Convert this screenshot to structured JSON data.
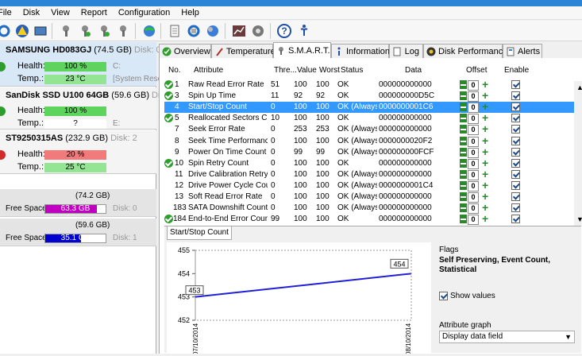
{
  "menu": [
    "File",
    "Disk",
    "View",
    "Report",
    "Configuration",
    "Help"
  ],
  "toolbar": [
    "refresh-icon",
    "warning-icon",
    "disk-icon",
    "wrench-icon",
    "wrench-icon",
    "wrench-icon",
    "wrench-icon",
    "globe-icon",
    "document-icon",
    "refresh-icon",
    "globe-arrows-icon",
    "chart-icon",
    "settings-icon",
    "help-icon",
    "info-icon"
  ],
  "disks": [
    {
      "name": "SAMSUNG HD083GJ",
      "size": "(74.5 GB)",
      "disk": "Disk: 0",
      "health_label": "Health:",
      "health": "100 %",
      "health_pct": 100,
      "health_color": "#5ed35e",
      "temp_label": "Temp.:",
      "temp": "23 °C",
      "temp_color": "#93e493",
      "vol1": "C:",
      "vol2": "[System Rese",
      "status": "ok"
    },
    {
      "name": "SanDisk SSD U100 64GB",
      "size": "(59.6 GB)",
      "disk": "Disk: 1",
      "health_label": "Health:",
      "health": "100 %",
      "health_pct": 100,
      "health_color": "#5ed35e",
      "temp_label": "Temp.:",
      "temp": "?",
      "temp_color": "#ffffff",
      "vol1": "E:",
      "vol2": "",
      "status": "ok"
    },
    {
      "name": "ST9250315AS",
      "size": "(232.9 GB)",
      "disk": "Disk: 2",
      "health_label": "Health:",
      "health": "20 %",
      "health_pct": 20,
      "health_color": "#f17a7a",
      "temp_label": "Temp.:",
      "temp": "25 °C",
      "temp_color": "#93e493",
      "vol1": "",
      "vol2": "",
      "status": "bad"
    }
  ],
  "volumes": [
    {
      "size": "(74.2 GB)",
      "label": "Free Space",
      "free": "63.3 GB",
      "free_pct": 85,
      "color": "#c000c0",
      "disk": "Disk: 0"
    },
    {
      "size": "(59.6 GB)",
      "label": "Free Space",
      "free": "35.1 GB",
      "free_pct": 59,
      "color": "#0000d0",
      "disk": "Disk: 1"
    }
  ],
  "tabs": [
    {
      "label": "Overview",
      "icon": "check-icon"
    },
    {
      "label": "Temperature",
      "icon": "thermometer-icon"
    },
    {
      "label": "S.M.A.R.T.",
      "icon": "wrench-icon"
    },
    {
      "label": "Information",
      "icon": "info-icon"
    },
    {
      "label": "Log",
      "icon": "log-icon"
    },
    {
      "label": "Disk Performance",
      "icon": "performance-icon"
    },
    {
      "label": "Alerts",
      "icon": "alerts-icon"
    }
  ],
  "smart": {
    "headers": {
      "no": "No.",
      "attribute": "Attribute",
      "threshold": "Thre...",
      "value": "Value",
      "worst": "Worst",
      "status": "Status",
      "data": "Data",
      "offset": "Offset",
      "enable": "Enable"
    },
    "rows": [
      {
        "icon": true,
        "no": "1",
        "attr": "Raw Read Error Rate",
        "thr": "51",
        "val": "100",
        "worst": "100",
        "status": "OK",
        "data": "000000000000",
        "offset": "0"
      },
      {
        "icon": true,
        "no": "3",
        "attr": "Spin Up Time",
        "thr": "11",
        "val": "92",
        "worst": "92",
        "status": "OK",
        "data": "000000000D5C",
        "offset": "0"
      },
      {
        "icon": false,
        "no": "4",
        "attr": "Start/Stop Count",
        "thr": "0",
        "val": "100",
        "worst": "100",
        "status": "OK (Always...",
        "data": "0000000001C6",
        "offset": "0",
        "selected": true
      },
      {
        "icon": true,
        "no": "5",
        "attr": "Reallocated Sectors Co...",
        "thr": "10",
        "val": "100",
        "worst": "100",
        "status": "OK",
        "data": "000000000000",
        "offset": "0"
      },
      {
        "icon": false,
        "no": "7",
        "attr": "Seek Error Rate",
        "thr": "0",
        "val": "253",
        "worst": "253",
        "status": "OK (Always...",
        "data": "000000000000",
        "offset": "0"
      },
      {
        "icon": false,
        "no": "8",
        "attr": "Seek Time Performance",
        "thr": "0",
        "val": "100",
        "worst": "100",
        "status": "OK (Always...",
        "data": "0000000020F2",
        "offset": "0"
      },
      {
        "icon": false,
        "no": "9",
        "attr": "Power On Time Count",
        "thr": "0",
        "val": "99",
        "worst": "99",
        "status": "OK (Always...",
        "data": "000000000FCF",
        "offset": "0"
      },
      {
        "icon": true,
        "no": "10",
        "attr": "Spin Retry Count",
        "thr": "0",
        "val": "100",
        "worst": "100",
        "status": "OK",
        "data": "000000000000",
        "offset": "0"
      },
      {
        "icon": false,
        "no": "11",
        "attr": "Drive Calibration Retry ...",
        "thr": "0",
        "val": "100",
        "worst": "100",
        "status": "OK (Always...",
        "data": "000000000000",
        "offset": "0"
      },
      {
        "icon": false,
        "no": "12",
        "attr": "Drive Power Cycle Count",
        "thr": "0",
        "val": "100",
        "worst": "100",
        "status": "OK (Always...",
        "data": "0000000001C4",
        "offset": "0"
      },
      {
        "icon": false,
        "no": "13",
        "attr": "Soft Read Error Rate",
        "thr": "0",
        "val": "100",
        "worst": "100",
        "status": "OK (Always...",
        "data": "000000000000",
        "offset": "0"
      },
      {
        "icon": false,
        "no": "183",
        "attr": "SATA Downshift Count",
        "thr": "0",
        "val": "100",
        "worst": "100",
        "status": "OK (Always...",
        "data": "000000000000",
        "offset": "0"
      },
      {
        "icon": true,
        "no": "184",
        "attr": "End-to-End Error Count",
        "thr": "99",
        "val": "100",
        "worst": "100",
        "status": "OK",
        "data": "000000000000",
        "offset": "0"
      }
    ]
  },
  "detail": {
    "subtab": "Start/Stop Count",
    "flags_title": "Flags",
    "flags_value": "Self Preserving, Event Count, Statistical",
    "show_values": "Show values",
    "attr_graph_label": "Attribute graph",
    "attr_graph_value": "Display data field"
  },
  "chart_data": {
    "type": "line",
    "x": [
      "07/10/2014",
      "08/10/2014"
    ],
    "y": [
      453,
      454
    ],
    "data_labels": [
      "453",
      "454"
    ],
    "yticks": [
      "455",
      "454",
      "453",
      "452"
    ],
    "ylim": [
      452,
      455
    ],
    "line_color": "#1f1fd6"
  }
}
